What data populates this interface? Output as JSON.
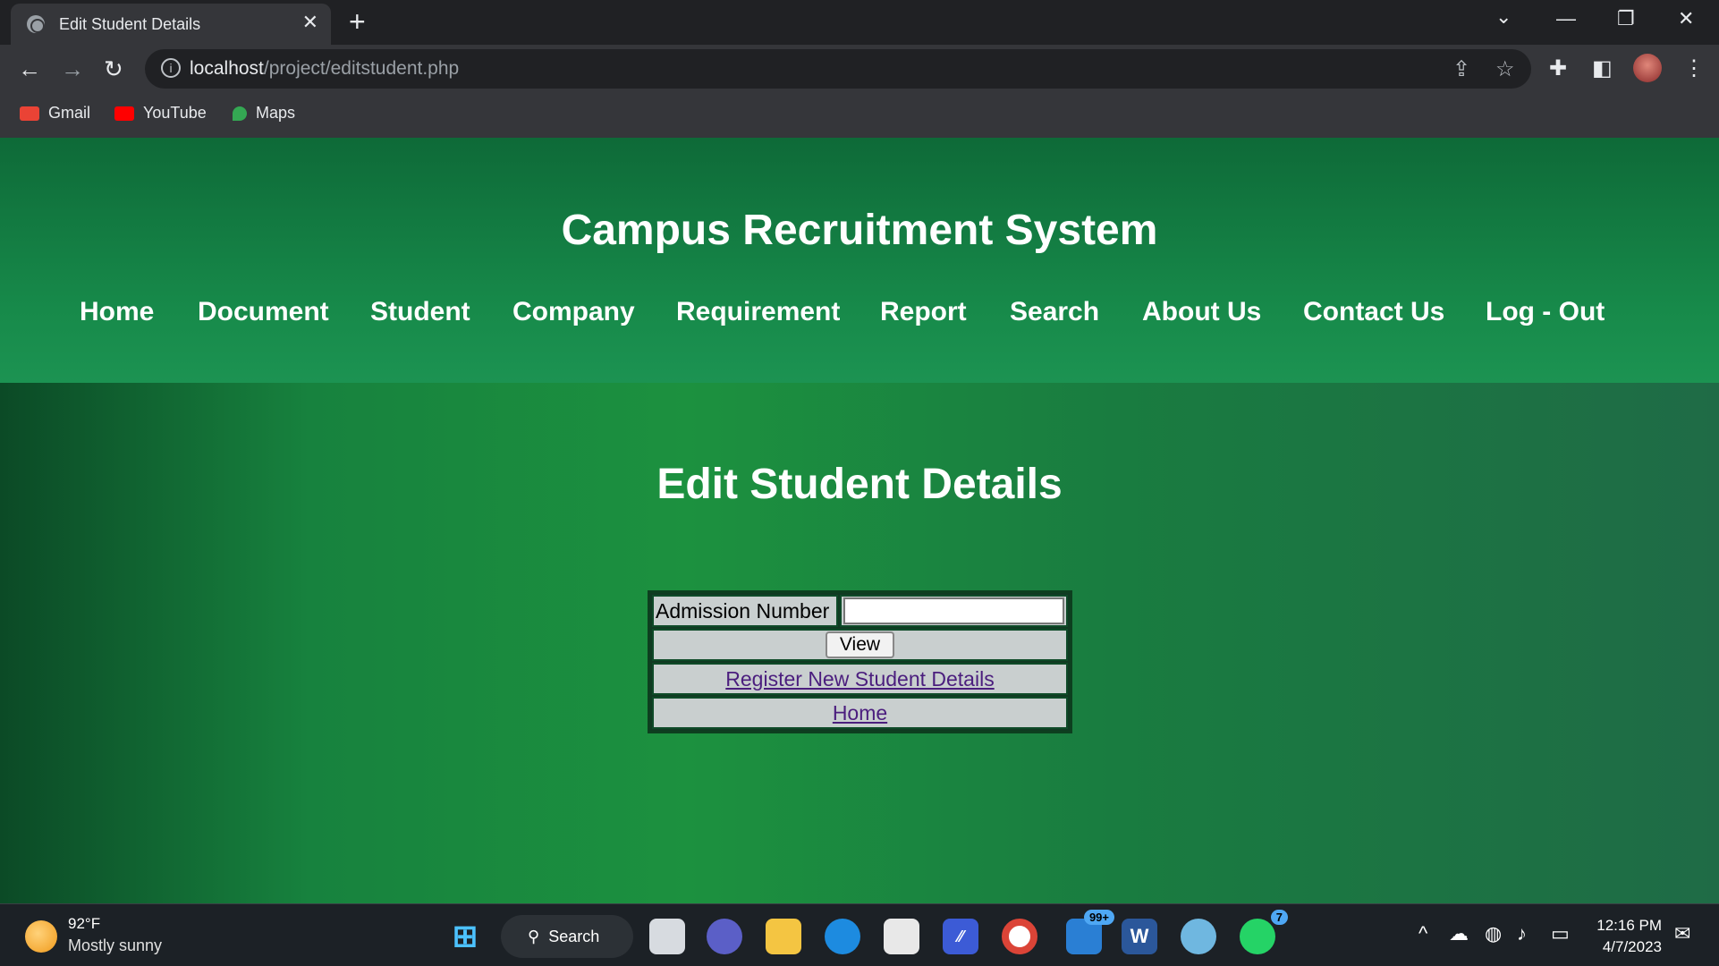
{
  "browser": {
    "tab_title": "Edit Student Details",
    "tab_close": "✕",
    "new_tab": "+",
    "url_host": "localhost",
    "url_path": "/project/editstudent.php",
    "bookmarks": [
      {
        "label": "Gmail",
        "color": "#ea4335"
      },
      {
        "label": "YouTube",
        "color": "#ff0000"
      },
      {
        "label": "Maps",
        "color": "#34a853"
      }
    ]
  },
  "header": {
    "site_title": "Campus Recruitment System",
    "nav": [
      "Home",
      "Document",
      "Student",
      "Company",
      "Requirement",
      "Report",
      "Search",
      "About Us",
      "Contact Us",
      "Log - Out"
    ]
  },
  "form": {
    "title": "Edit Student Details",
    "admission_label": "Admission Number",
    "admission_value": "",
    "view_button": "View",
    "register_link": "Register New Student Details",
    "home_link": "Home"
  },
  "taskbar": {
    "weather_temp": "92°F",
    "weather_desc": "Mostly sunny",
    "search_label": "Search",
    "teams_badge": "99+",
    "whatsapp_badge": "7",
    "time": "12:16 PM",
    "date": "4/7/2023"
  },
  "colors": {
    "header_green": "#178a4a",
    "page_green": "#1c913f",
    "link_purple": "#4b1e7e"
  }
}
